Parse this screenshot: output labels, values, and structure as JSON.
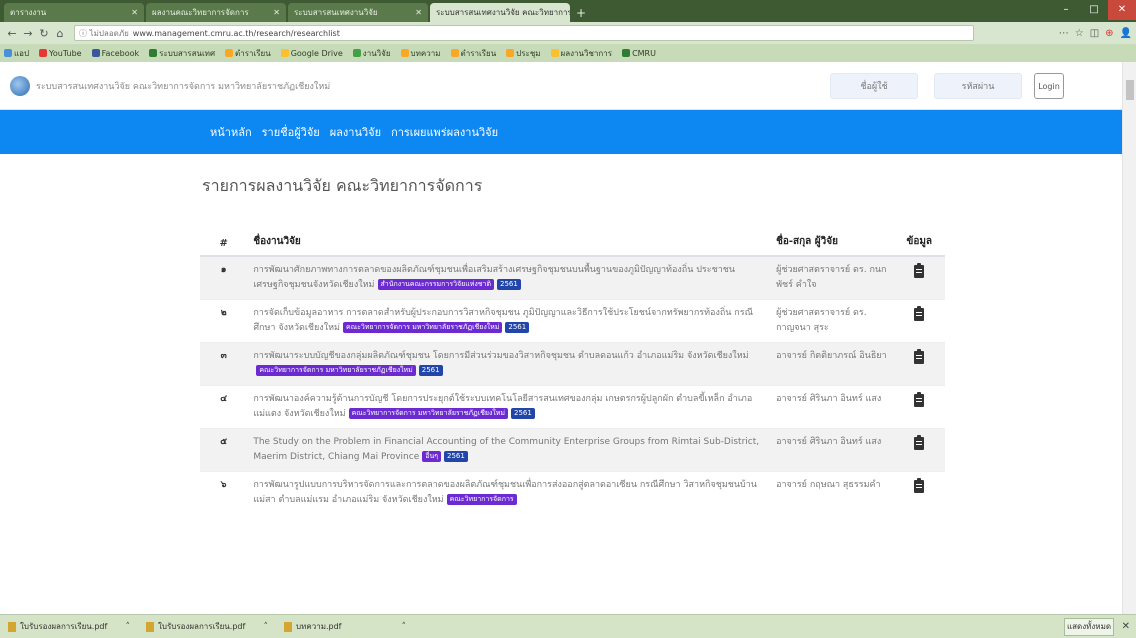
{
  "browser": {
    "tabs": [
      {
        "label": "ตารางงาน",
        "active": false
      },
      {
        "label": "ผลงานคณะวิทยาการจัดการ",
        "active": false
      },
      {
        "label": "ระบบสารสนเทศงานวิจัย",
        "active": false
      },
      {
        "label": "ระบบสารสนเทศงานวิจัย คณะวิทยาการจัดการ",
        "active": true
      }
    ],
    "new_tab": "+",
    "window_controls": {
      "minimize": "–",
      "maximize": "□",
      "close": "✕"
    },
    "nav": {
      "back": "←",
      "forward": "→",
      "reload": "↻",
      "home": "⌂"
    },
    "address": {
      "info": "ⓘ ไม่ปลอดภัย",
      "url": "www.management.cmru.ac.th/research/researchlist"
    },
    "toolbar_icons": {
      "menu": "⋯",
      "star": "☆",
      "extension": "◫",
      "pocket": "⊕",
      "account": "👤"
    },
    "bookmarks": [
      {
        "label": "แอป",
        "color": "#4a90d9"
      },
      {
        "label": "YouTube",
        "color": "#e53935"
      },
      {
        "label": "Facebook",
        "color": "#3b5998"
      },
      {
        "label": "ระบบสารสนเทศ",
        "color": "#2e7d32"
      },
      {
        "label": "ตำราเรียน",
        "color": "#f9a825"
      },
      {
        "label": "Google Drive",
        "color": "#fbc02d"
      },
      {
        "label": "งานวิจัย",
        "color": "#43a047"
      },
      {
        "label": "บทความ",
        "color": "#f9a825"
      },
      {
        "label": "ตำราเรียน",
        "color": "#f9a825"
      },
      {
        "label": "ประชุม",
        "color": "#f9a825"
      },
      {
        "label": "ผลงานวิชาการ",
        "color": "#fbc02d"
      },
      {
        "label": "CMRU",
        "color": "#2e7d32"
      }
    ]
  },
  "site": {
    "title": "ระบบสารสนเทศงานวิจัย คณะวิทยาการจัดการ มหาวิทยาลัยราชภัฏเชียงใหม่",
    "username_placeholder": "ชื่อผู้ใช้",
    "password_placeholder": "รหัสผ่าน",
    "login_label": "Login"
  },
  "nav": {
    "home": "หน้าหลัก",
    "researchers": "รายชื่อผู้วิจัย",
    "research": "ผลงานวิจัย",
    "publishing": "การเผยแพร่ผลงานวิจัย"
  },
  "content": {
    "heading": "รายการผลงานวิจัย คณะวิทยาการจัดการ",
    "columns": {
      "num": "#",
      "title": "ชื่องานวิจัย",
      "author": "ชื่อ-สกุล ผู้วิจัย",
      "info": "ข้อมูล"
    },
    "rows": [
      {
        "num": "๑",
        "title": "การพัฒนาศักยภาพทางการตลาดของผลิตภัณฑ์ชุมชนเพื่อเสริมสร้างเศรษฐกิจชุมชนบนพื้นฐานของภูมิปัญญาท้องถิ่น ประชาชนเศรษฐกิจชุมชนจังหวัดเชียงใหม่",
        "badges": [
          {
            "text": "สำนักงานคณะกรรมการวิจัยแห่งชาติ",
            "kind": "cat"
          },
          {
            "text": "2561",
            "kind": "year"
          }
        ],
        "author": "ผู้ช่วยศาสตราจารย์ ดร. กนกพัชร์ คำใจ",
        "striped": true
      },
      {
        "num": "๒",
        "title": "การจัดเก็บข้อมูลอาหาร การตลาดสำหรับผู้ประกอบการวิสาหกิจชุมชน ภูมิปัญญาและวิธีการใช้ประโยชน์จากทรัพยากรท้องถิ่น กรณีศึกษา จังหวัดเชียงใหม่",
        "badges": [
          {
            "text": "คณะวิทยาการจัดการ มหาวิทยาลัยราชภัฏเชียงใหม่",
            "kind": "cat"
          },
          {
            "text": "2561",
            "kind": "year"
          }
        ],
        "author": "ผู้ช่วยศาสตราจารย์ ดร. กาญจนา สุระ",
        "striped": false
      },
      {
        "num": "๓",
        "title": "การพัฒนาระบบบัญชีของกลุ่มผลิตภัณฑ์ชุมชน โดยการมีส่วนร่วมของวิสาหกิจชุมชน ตำบลดอนแก้ว อำเภอแม่ริม จังหวัดเชียงใหม่",
        "badges": [
          {
            "text": "คณะวิทยาการจัดการ มหาวิทยาลัยราชภัฏเชียงใหม่",
            "kind": "cat"
          },
          {
            "text": "2561",
            "kind": "year"
          }
        ],
        "author": "อาจารย์ กิตติยาภรณ์ อินธิยา",
        "striped": true
      },
      {
        "num": "๔",
        "title": "การพัฒนาองค์ความรู้ด้านการบัญชี โดยการประยุกต์ใช้ระบบเทคโนโลยีสารสนเทศของกลุ่ม เกษตรกรผู้ปลูกผัก ตำบลขี้เหล็ก อำเภอแม่แตง จังหวัดเชียงใหม่",
        "badges": [
          {
            "text": "คณะวิทยาการจัดการ มหาวิทยาลัยราชภัฏเชียงใหม่",
            "kind": "cat"
          },
          {
            "text": "2561",
            "kind": "year"
          }
        ],
        "author": "อาจารย์ ศิรินภา อินทร์ แสง",
        "striped": false
      },
      {
        "num": "๕",
        "title": "The Study on the Problem in Financial Accounting of the Community Enterprise Groups from Rimtai Sub-District, Maerim District, Chiang Mai Province",
        "badges": [
          {
            "text": "อื่นๆ",
            "kind": "cat"
          },
          {
            "text": "2561",
            "kind": "year"
          }
        ],
        "author": "อาจารย์ ศิรินภา อินทร์ แสง",
        "striped": true
      },
      {
        "num": "๖",
        "title": "การพัฒนารูปแบบการบริหารจัดการและการตลาดของผลิตภัณฑ์ชุมชนเพื่อการส่งออกสู่ตลาดอาเซียน กรณีศึกษา วิสาหกิจชุมชนบ้านแม่สา ตำบลแม่แรม อำเภอแม่ริม จังหวัดเชียงใหม่",
        "badges": [
          {
            "text": "คณะวิทยาการจัดการ",
            "kind": "cat"
          }
        ],
        "author": "อาจารย์ กฤษณา สุธรรมคำ",
        "striped": false
      }
    ]
  },
  "downloads": [
    {
      "label": "ใบรับรองผลการเรียน.pdf"
    },
    {
      "label": "ใบรับรองผลการเรียน.pdf"
    },
    {
      "label": "บทความ.pdf"
    }
  ],
  "downloads_show_all": "แสดงทั้งหมด",
  "downloads_close": "✕",
  "download_menu_caret": "˄"
}
